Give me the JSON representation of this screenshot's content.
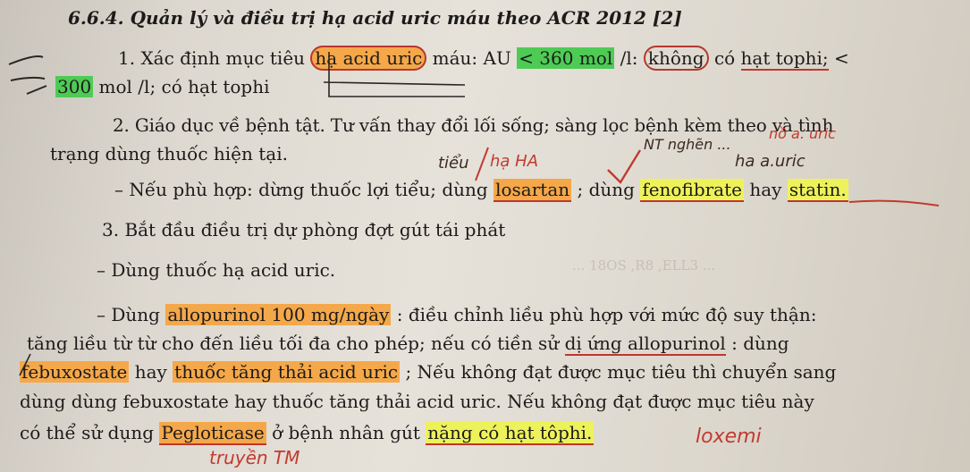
{
  "heading": "6.6.4. Quản lý và điều trị hạ acid uric máu theo ACR 2012 [2]",
  "item1": {
    "a": "1. Xác định mục tiêu",
    "b": "hạ acid uric",
    "c": "máu: AU",
    "d": "< 360 mol",
    "e": "/l:",
    "f": "không",
    "g": "có",
    "h": "hạt tophi;",
    "i": "<"
  },
  "item1_line2": {
    "a": "300",
    "b": "mol /l;",
    "c": "có hạt tophi"
  },
  "item2": {
    "a": "2. Giáo dục về bệnh tật. Tư vấn thay đổi lối sống; sàng lọc bệnh kèm theo và tình",
    "b": "trạng dùng thuốc hiện tại."
  },
  "bullet1": {
    "a": "–  Nếu phù hợp: dừng thuốc lợi tiểu; dùng",
    "b": "losartan",
    "c": "; dùng",
    "d": "fenofibrate",
    "e": "hay",
    "f": "statin."
  },
  "item3": "3. Bắt đầu điều trị dự phòng đợt gút tái phát",
  "bullet2": "–  Dùng thuốc hạ acid uric.",
  "bullet3": {
    "a": "–  Dùng",
    "b": "allopurinol 100 mg/ngày",
    "c": ": điều chỉnh liều phù hợp với mức độ suy thận:"
  },
  "para1": {
    "a": "tăng liều từ từ cho đến liều tối đa cho phép; nếu có tiền sử",
    "b": "dị ứng allopurinol",
    "c": ": dùng"
  },
  "para2": {
    "a": "febuxostate",
    "b": "hay",
    "c": "thuốc tăng thải acid uric",
    "d": "; Nếu không đạt được mục tiêu thì chuyển sang"
  },
  "para3": "dùng dùng febuxostate hay thuốc tăng thải acid uric. Nếu không đạt được mục tiêu này",
  "para4": {
    "a": "có thể sử dụng",
    "b": "Pegloticase",
    "c": "ở bệnh nhân gút",
    "d": "nặng có hạt tôphi.",
    "e": ""
  },
  "notes": {
    "n1": "tiểu",
    "n2": "hạ HA",
    "n3": "NT nghẽn ...",
    "n4": "nồ a. uric",
    "n5": "ha a.uric",
    "n6": "loxemi",
    "n7": "truyền TM"
  },
  "ghost_text": "... 18OS ,R8 ,ELL3 ..."
}
